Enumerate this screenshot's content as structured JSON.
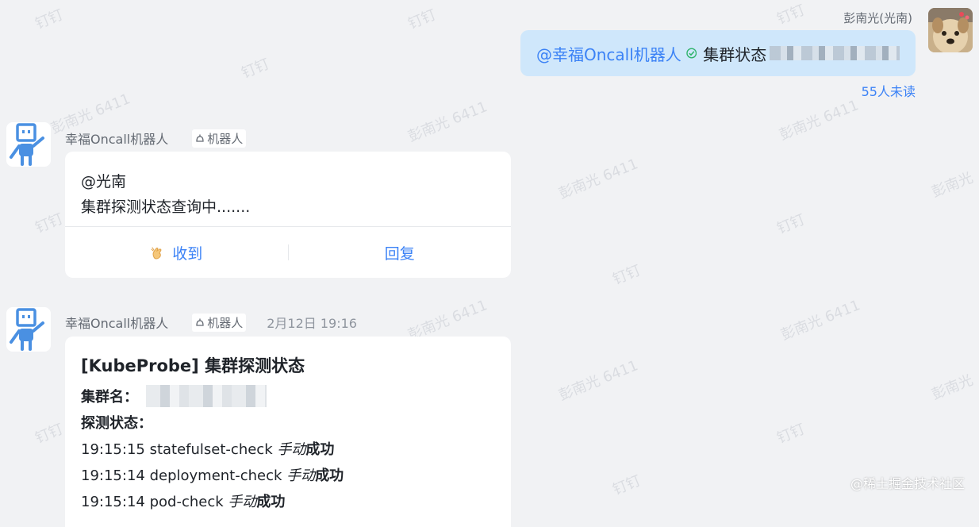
{
  "watermarks": {
    "name_id": "彭南光 6411",
    "name": "彭南光",
    "app": "钉钉"
  },
  "right_message": {
    "sender": "彭南光(光南)",
    "mention": "@幸福Oncall机器人",
    "text": "集群状态",
    "read_status": "55人未读"
  },
  "message1": {
    "sender": "幸福Oncall机器人",
    "tag": "机器人",
    "mention": "@光南",
    "text": "集群探测状态查询中.......",
    "action_ack": "收到",
    "action_reply": "回复"
  },
  "message2": {
    "sender": "幸福Oncall机器人",
    "tag": "机器人",
    "timestamp": "2月12日 19:16",
    "title": "[KubeProbe] 集群探测状态",
    "cluster_label": "集群名：",
    "status_label": "探测状态：",
    "checks": [
      {
        "time": "19:15:15",
        "name": "statefulset-check",
        "mode": "手动",
        "result": "成功"
      },
      {
        "time": "19:15:14",
        "name": "deployment-check",
        "mode": "手动",
        "result": "成功"
      },
      {
        "time": "19:15:14",
        "name": "pod-check",
        "mode": "手动",
        "result": "成功"
      }
    ]
  },
  "credit": "@稀土掘金技术社区",
  "colors": {
    "background": "#f1f2f4",
    "bubble_blue": "#cfe7fb",
    "link_blue": "#3b82f6",
    "robot_blue": "#4a90e2"
  }
}
